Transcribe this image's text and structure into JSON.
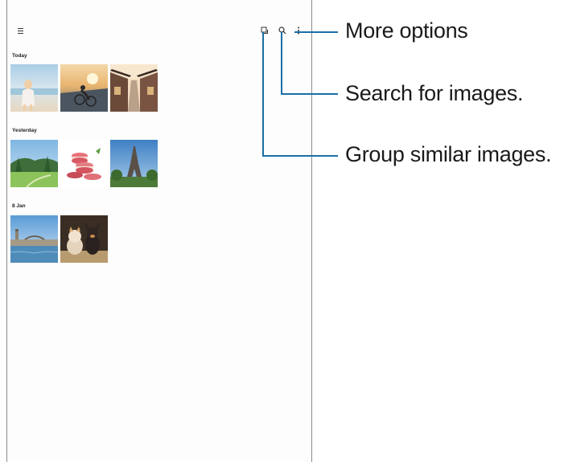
{
  "icons": {
    "menu": "menu-icon",
    "group_similar": "group-similar-icon",
    "search": "search-icon",
    "more": "more-options-icon"
  },
  "sections": [
    {
      "title": "Today",
      "photos": [
        "child-on-beach",
        "cyclist-at-sunset",
        "village-street"
      ]
    },
    {
      "title": "Yesterday",
      "photos": [
        "green-park",
        "macarons",
        "eiffel-tower"
      ]
    },
    {
      "title": "8 Jan",
      "photos": [
        "river-city-bridge",
        "cat-and-dog"
      ]
    }
  ],
  "callouts": {
    "more_options": "More options",
    "search": "Search for images.",
    "group": "Group similar images."
  },
  "colors": {
    "callout_line": "#1a6fa8",
    "background": "#fdfdfd"
  }
}
